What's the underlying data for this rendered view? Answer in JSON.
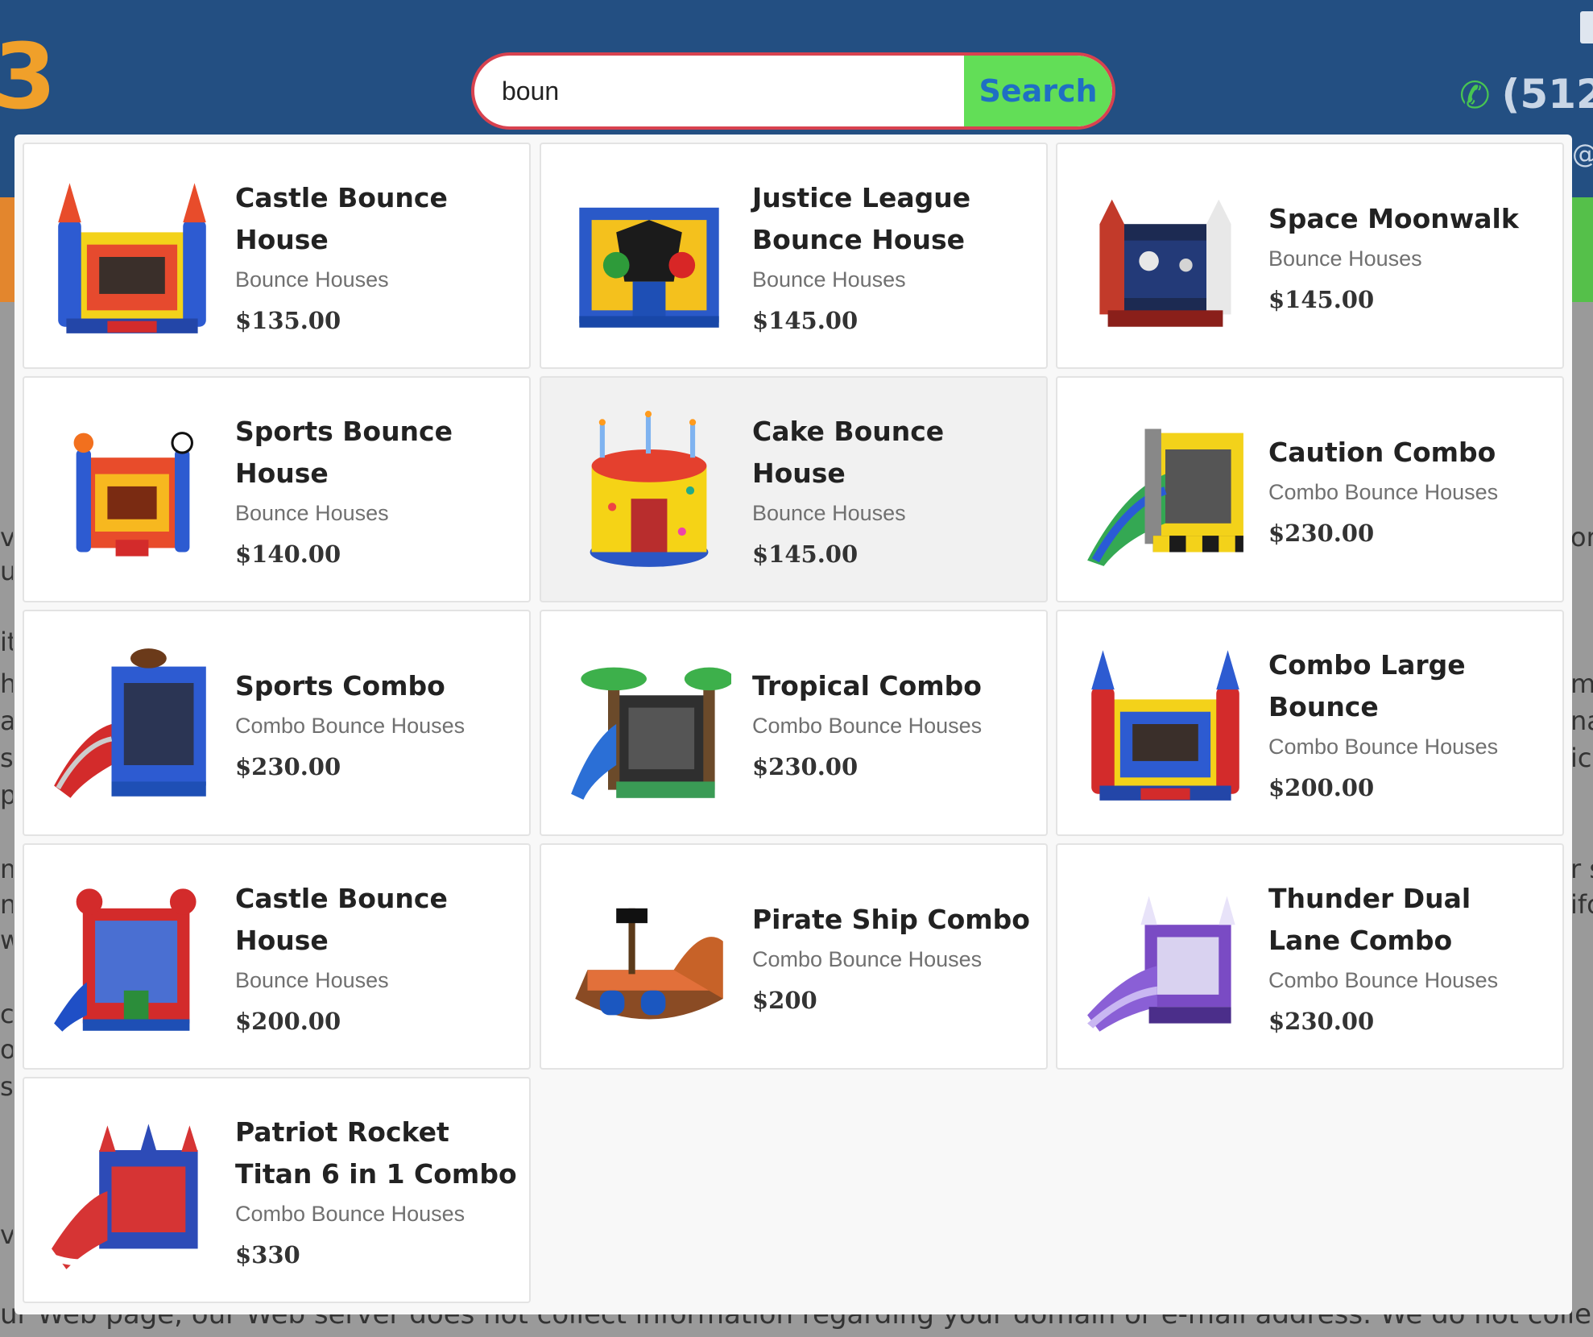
{
  "header": {
    "logo_fragment": "3",
    "phone_fragment": "(512",
    "email_fragment": "@"
  },
  "search": {
    "value": "boun",
    "button_label": "Search"
  },
  "background_text": {
    "bottom_line": "ur Web page, our Web server does not collect information regarding your domain or e-mail address. We do not collect information or",
    "left_fragments": [
      "vo",
      "ur",
      "it",
      "he",
      "al",
      "s",
      "p",
      "m",
      "n",
      "w",
      "c",
      "of",
      "s:",
      "vi"
    ],
    "right_fragments": [
      "or",
      "mi",
      "na",
      "icl",
      "r s",
      "ifo"
    ]
  },
  "results": [
    {
      "name": "Castle Bounce House",
      "category": "Bounce Houses",
      "price": "$135.00",
      "image": "castle-bounce-house-image"
    },
    {
      "name": "Justice League Bounce House",
      "category": "Bounce Houses",
      "price": "$145.00",
      "image": "justice-league-bounce-house-image"
    },
    {
      "name": "Space Moonwalk",
      "category": "Bounce Houses",
      "price": "$145.00",
      "image": "space-moonwalk-image"
    },
    {
      "name": "Sports Bounce House",
      "category": "Bounce Houses",
      "price": "$140.00",
      "image": "sports-bounce-house-image"
    },
    {
      "name": "Cake Bounce House",
      "category": "Bounce Houses",
      "price": "$145.00",
      "image": "cake-bounce-house-image"
    },
    {
      "name": "Caution Combo",
      "category": "Combo Bounce Houses",
      "price": "$230.00",
      "image": "caution-combo-image"
    },
    {
      "name": "Sports Combo",
      "category": "Combo Bounce Houses",
      "price": "$230.00",
      "image": "sports-combo-image"
    },
    {
      "name": "Tropical Combo",
      "category": "Combo Bounce Houses",
      "price": "$230.00",
      "image": "tropical-combo-image"
    },
    {
      "name": "Combo Large Bounce",
      "category": "Combo Bounce Houses",
      "price": "$200.00",
      "image": "combo-large-bounce-image"
    },
    {
      "name": "Castle Bounce House",
      "category": "Bounce Houses",
      "price": "$200.00",
      "image": "spiderman-castle-image"
    },
    {
      "name": "Pirate Ship Combo",
      "category": "Combo Bounce Houses",
      "price": "$200",
      "image": "pirate-ship-combo-image"
    },
    {
      "name": "Thunder Dual Lane Combo",
      "category": "Combo Bounce Houses",
      "price": "$230.00",
      "image": "thunder-dual-lane-combo-image"
    },
    {
      "name": "Patriot Rocket Titan 6 in 1 Combo",
      "category": "Combo Bounce Houses",
      "price": "$330",
      "image": "patriot-rocket-titan-image"
    }
  ],
  "colors": {
    "header_bg": "#234f82",
    "search_border": "#d8424f",
    "search_button_bg": "#62de57",
    "search_button_text": "#1f6fc4",
    "logo": "#f0a02a",
    "phone_icon": "#48c552"
  }
}
